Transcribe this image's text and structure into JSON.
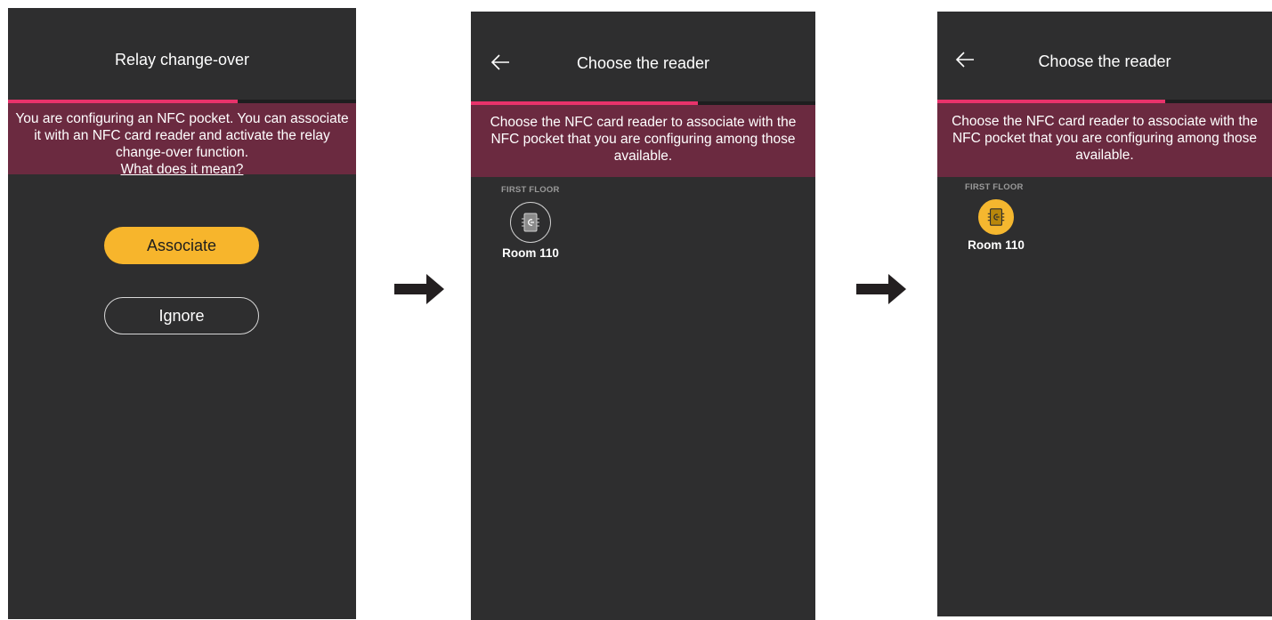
{
  "screens": [
    {
      "title": "Relay change-over",
      "progress": 0.66,
      "banner_text": "You are configuring an NFC pocket. You can associate it with an NFC card reader and activate the relay change-over function.",
      "banner_link": "What does it mean?",
      "associate_label": "Associate",
      "ignore_label": "Ignore"
    },
    {
      "title": "Choose the reader",
      "progress": 0.66,
      "banner_text": "Choose the NFC card reader to associate with the NFC pocket that you are configuring among those available.",
      "section": "FIRST FLOOR",
      "reader_label": "Room 110",
      "reader_selected": false
    },
    {
      "title": "Choose the reader",
      "progress": 0.68,
      "banner_text": "Choose the NFC card reader to associate with the NFC pocket that you are configuring among those available.",
      "section": "FIRST FLOOR",
      "reader_label": "Room 110",
      "reader_selected": true
    }
  ],
  "colors": {
    "background": "#2e2e2f",
    "accent": "#e8336b",
    "banner": "#6b2a40",
    "button_primary": "#f7b52c"
  },
  "icons": [
    "back-arrow-icon",
    "nfc-reader-icon",
    "right-arrow-icon"
  ]
}
